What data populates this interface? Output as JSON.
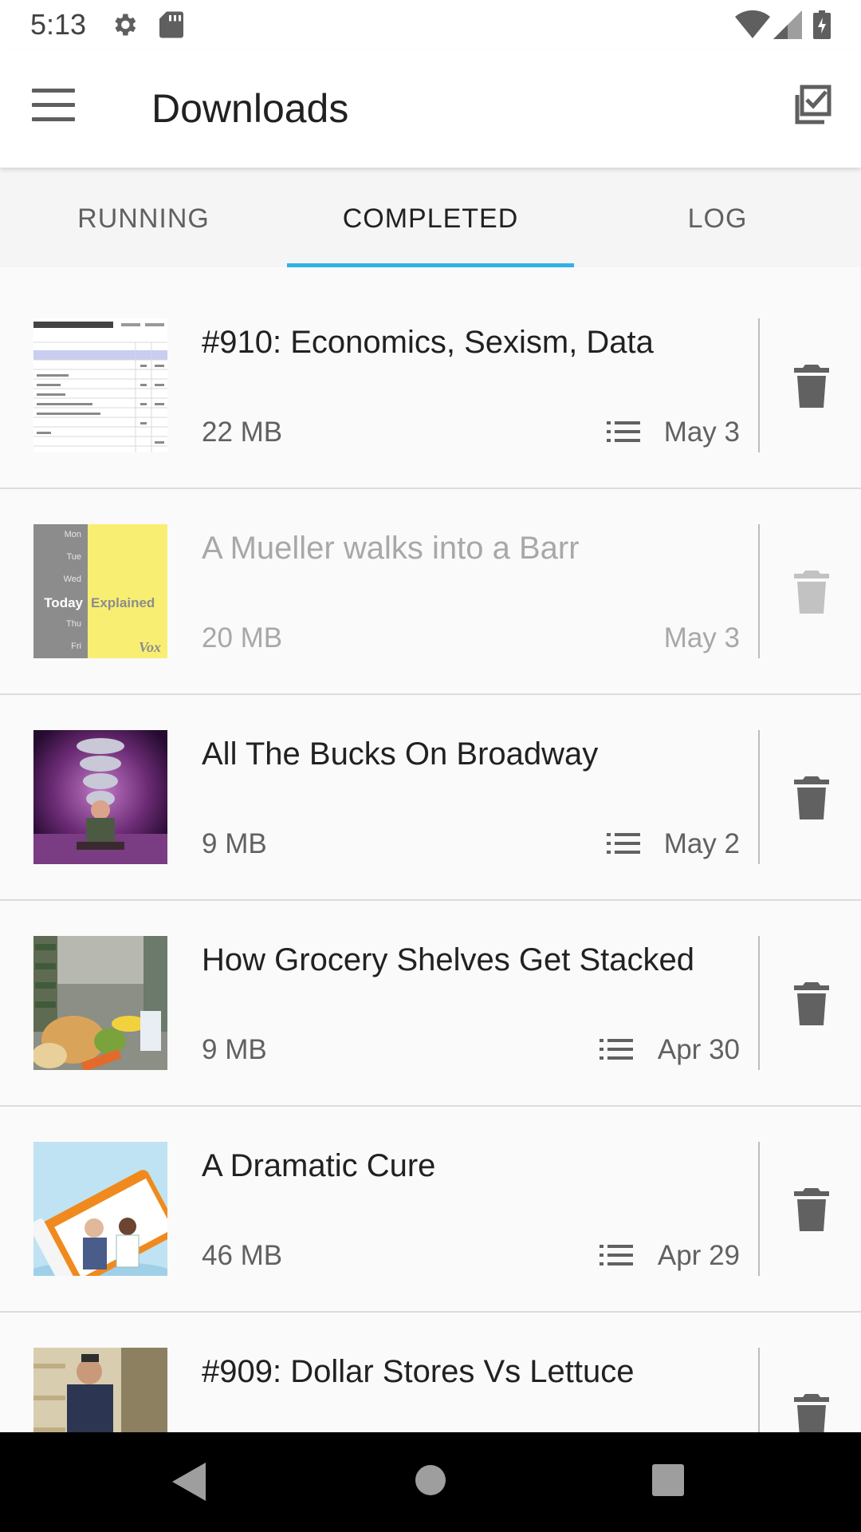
{
  "status_bar": {
    "time": "5:13",
    "icons": [
      "settings-icon",
      "sd-card-icon",
      "wifi-icon",
      "signal-icon",
      "battery-charging-icon"
    ]
  },
  "toolbar": {
    "title": "Downloads",
    "menu_icon": "hamburger-menu-icon",
    "action_icon": "select-all-checkbox-icon"
  },
  "tabs": [
    {
      "label": "RUNNING",
      "active": false
    },
    {
      "label": "COMPLETED",
      "active": true
    },
    {
      "label": "LOG",
      "active": false
    }
  ],
  "downloads": [
    {
      "title": "#910: Economics, Sexism, Data",
      "size": "22 MB",
      "date": "May 3",
      "has_queue_icon": true,
      "dimmed": false,
      "thumbnail": "spreadsheet"
    },
    {
      "title": "A Mueller walks into a Barr",
      "size": "20 MB",
      "date": "May 3",
      "has_queue_icon": false,
      "dimmed": true,
      "thumbnail": "today-explained"
    },
    {
      "title": "All The Bucks On Broadway",
      "size": "9 MB",
      "date": "May 2",
      "has_queue_icon": true,
      "dimmed": false,
      "thumbnail": "stage"
    },
    {
      "title": "How Grocery Shelves Get Stacked",
      "size": "9 MB",
      "date": "Apr 30",
      "has_queue_icon": true,
      "dimmed": false,
      "thumbnail": "grocery"
    },
    {
      "title": "A Dramatic Cure",
      "size": "46 MB",
      "date": "Apr 29",
      "has_queue_icon": true,
      "dimmed": false,
      "thumbnail": "pill-bottle"
    },
    {
      "title": "#909: Dollar Stores Vs Lettuce",
      "size": "",
      "date": "",
      "has_queue_icon": false,
      "dimmed": false,
      "thumbnail": "store"
    }
  ],
  "thumb_text": {
    "days": [
      "Mon",
      "Tue",
      "Wed",
      "Thu",
      "Fri"
    ],
    "today": "Today",
    "explained": "Explained",
    "brand": "Vox"
  },
  "colors": {
    "accent": "#2fb3e6",
    "background": "#fafafa",
    "tab_background": "#f5f5f5",
    "icon_grey": "#5f5f5f"
  }
}
